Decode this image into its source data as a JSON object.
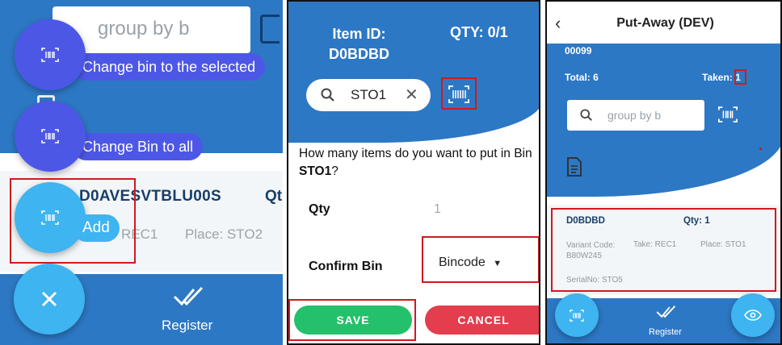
{
  "colors": {
    "primary_blue": "#2d78c4",
    "fab_dark": "#4d57e6",
    "fab_light": "#3eb4f0",
    "save_green": "#25c06b",
    "cancel_red": "#e33d4e",
    "highlight_red": "#d1191f"
  },
  "panel1": {
    "search_placeholder": "group by b",
    "fab_change_selected_label": "Change bin to the selected",
    "fab_change_all_label": "Change Bin to all",
    "fab_add_label": "Add",
    "item_title": "D0AVESVTBLU00S",
    "item_qty": "Qt",
    "item_take": "REC1",
    "item_place": "Place: STO2",
    "close_icon": "close-icon",
    "register_label": "Register"
  },
  "panel2": {
    "item_id_label": "Item ID:",
    "item_id_value": "D0BDBD",
    "qty_text": "QTY: 0/1",
    "search_value": "STO1",
    "question_prefix": "How many items do you want to put in Bin ",
    "question_bin": "STO1",
    "question_suffix": "?",
    "qty_label": "Qty",
    "qty_value": "1",
    "confirm_bin_label": "Confirm Bin",
    "bincode_selected": "Bincode",
    "save_label": "SAVE",
    "cancel_label": "CANCEL"
  },
  "panel3": {
    "title": "Put-Away (DEV)",
    "code": "00099",
    "total_text": "Total: 6",
    "taken_prefix": "Taken: ",
    "taken_value": "1",
    "search_placeholder": "group by b",
    "card_title": "D0BDBD",
    "card_qty": "Qty: 1",
    "variant_label": "Variant Code:",
    "variant_value": "B80W245",
    "take_text": "Take: REC1",
    "place_text": "Place: STO1",
    "serial_text": "SerialNo: STO5",
    "register_label": "Register"
  }
}
